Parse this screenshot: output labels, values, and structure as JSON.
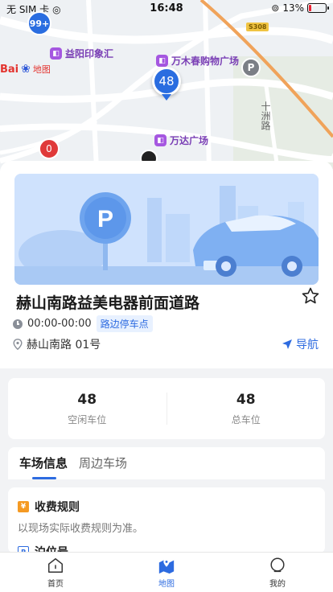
{
  "status_bar": {
    "carrier": "无 SIM 卡",
    "time": "16:48",
    "battery": "13%",
    "battery_level": 0.13
  },
  "map": {
    "pois": [
      {
        "name": "益阳印象汇"
      },
      {
        "name": "万木春购物广场"
      },
      {
        "name": "万达广场"
      }
    ],
    "baidu_logo": "Bai",
    "baidu_sub": "地图",
    "road_label": "十洲路",
    "highway_shield": "S308",
    "cluster_label": "99+",
    "selected_marker": "48",
    "red_marker": "0",
    "grey_marker": "P",
    "colors": {
      "accent": "#2d6be0",
      "road_orange": "#f0a35a"
    }
  },
  "lot": {
    "name": "赫山南路益美电器前面道路",
    "hours": "00:00-00:00",
    "type_tag": "路边停车点",
    "address": "赫山南路 01号",
    "nav_label": "导航",
    "banner_sign": "P"
  },
  "stats": [
    {
      "value": "48",
      "label": "空闲车位"
    },
    {
      "value": "48",
      "label": "总车位"
    }
  ],
  "tabs": [
    {
      "label": "车场信息",
      "active": true
    },
    {
      "label": "周边车场",
      "active": false
    }
  ],
  "fee": {
    "title": "收费规则",
    "text": "以现场实际收费规则为准。"
  },
  "berth": {
    "title": "泊位号"
  },
  "bottom_nav": [
    {
      "label": "首页",
      "icon": "home-icon",
      "active": false
    },
    {
      "label": "地图",
      "icon": "map-pin-icon",
      "active": true
    },
    {
      "label": "我的",
      "icon": "profile-icon",
      "active": false
    }
  ]
}
